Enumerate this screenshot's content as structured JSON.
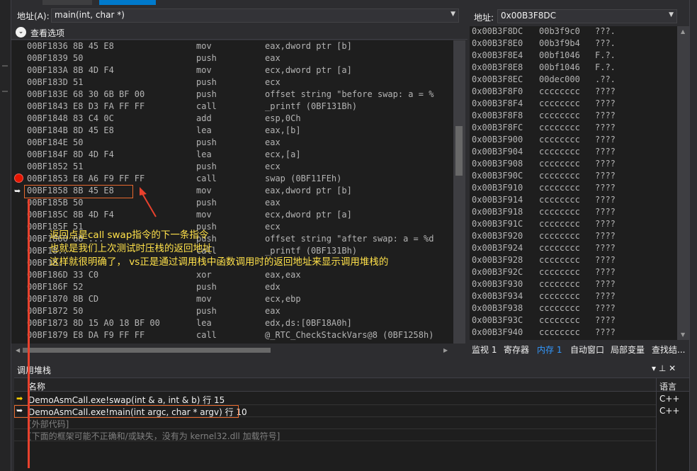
{
  "disasm": {
    "address_label": "地址(A):",
    "address_value": "main(int, char *)",
    "view_options_label": "查看选项",
    "rows": [
      {
        "addr": "00BF1836 8B 45 E8",
        "op": "mov",
        "arg": "eax,dword ptr [b]"
      },
      {
        "addr": "00BF1839 50",
        "op": "push",
        "arg": "eax"
      },
      {
        "addr": "00BF183A 8B 4D F4",
        "op": "mov",
        "arg": "ecx,dword ptr [a]"
      },
      {
        "addr": "00BF183D 51",
        "op": "push",
        "arg": "ecx"
      },
      {
        "addr": "00BF183E 68 30 6B BF 00",
        "op": "push",
        "arg": "offset string \"before swap: a = %"
      },
      {
        "addr": "00BF1843 E8 D3 FA FF FF",
        "op": "call",
        "arg": "_printf (0BF131Bh)"
      },
      {
        "addr": "00BF1848 83 C4 0C",
        "op": "add",
        "arg": "esp,0Ch"
      },
      {
        "addr": "00BF184B 8D 45 E8",
        "op": "lea",
        "arg": "eax,[b]"
      },
      {
        "addr": "00BF184E 50",
        "op": "push",
        "arg": "eax"
      },
      {
        "addr": "00BF184F 8D 4D F4",
        "op": "lea",
        "arg": "ecx,[a]"
      },
      {
        "addr": "00BF1852 51",
        "op": "push",
        "arg": "ecx"
      },
      {
        "addr": "00BF1853 E8 A6 F9 FF FF",
        "op": "call",
        "arg": "swap (0BF11FEh)"
      },
      {
        "addr": "00BF1858 8B 45 E8",
        "op": "mov",
        "arg": "eax,dword ptr [b]"
      },
      {
        "addr": "00BF185B 50",
        "op": "push",
        "arg": "eax"
      },
      {
        "addr": "00BF185C 8B 4D F4",
        "op": "mov",
        "arg": "ecx,dword ptr [a]"
      },
      {
        "addr": "00BF185F 51",
        "op": "push",
        "arg": "ecx"
      },
      {
        "addr": "00BF1860 68 ...",
        "op": "push",
        "arg": "offset string \"after swap: a = %d"
      },
      {
        "addr": "00BF18..",
        "op": "call",
        "arg": "_printf (0BF131Bh)"
      },
      {
        "addr": "00BF18..",
        "op": "",
        "arg": ""
      },
      {
        "addr": "00BF186D 33 C0",
        "op": "xor",
        "arg": "eax,eax"
      },
      {
        "addr": "00BF186F 52",
        "op": "push",
        "arg": "edx"
      },
      {
        "addr": "00BF1870 8B CD",
        "op": "mov",
        "arg": "ecx,ebp"
      },
      {
        "addr": "00BF1872 50",
        "op": "push",
        "arg": "eax"
      },
      {
        "addr": "00BF1873 8D 15 A0 18 BF 00",
        "op": "lea",
        "arg": "edx,ds:[0BF18A0h]"
      },
      {
        "addr": "00BF1879 E8 DA F9 FF FF",
        "op": "call",
        "arg": "@_RTC_CheckStackVars@8 (0BF1258h)"
      }
    ]
  },
  "memory": {
    "address_label": "地址:",
    "address_value": "0x00B3F8DC",
    "rows": [
      {
        "a": "0x00B3F8DC",
        "v": "00b3f9c0",
        "c": "???."
      },
      {
        "a": "0x00B3F8E0",
        "v": "00b3f9b4",
        "c": "???."
      },
      {
        "a": "0x00B3F8E4",
        "v": "00bf1046",
        "c": "F.?."
      },
      {
        "a": "0x00B3F8E8",
        "v": "00bf1046",
        "c": "F.?."
      },
      {
        "a": "0x00B3F8EC",
        "v": "00dec000",
        "c": ".??."
      },
      {
        "a": "0x00B3F8F0",
        "v": "cccccccc",
        "c": "????"
      },
      {
        "a": "0x00B3F8F4",
        "v": "cccccccc",
        "c": "????"
      },
      {
        "a": "0x00B3F8F8",
        "v": "cccccccc",
        "c": "????"
      },
      {
        "a": "0x00B3F8FC",
        "v": "cccccccc",
        "c": "????"
      },
      {
        "a": "0x00B3F900",
        "v": "cccccccc",
        "c": "????"
      },
      {
        "a": "0x00B3F904",
        "v": "cccccccc",
        "c": "????"
      },
      {
        "a": "0x00B3F908",
        "v": "cccccccc",
        "c": "????"
      },
      {
        "a": "0x00B3F90C",
        "v": "cccccccc",
        "c": "????"
      },
      {
        "a": "0x00B3F910",
        "v": "cccccccc",
        "c": "????"
      },
      {
        "a": "0x00B3F914",
        "v": "cccccccc",
        "c": "????"
      },
      {
        "a": "0x00B3F918",
        "v": "cccccccc",
        "c": "????"
      },
      {
        "a": "0x00B3F91C",
        "v": "cccccccc",
        "c": "????"
      },
      {
        "a": "0x00B3F920",
        "v": "cccccccc",
        "c": "????"
      },
      {
        "a": "0x00B3F924",
        "v": "cccccccc",
        "c": "????"
      },
      {
        "a": "0x00B3F928",
        "v": "cccccccc",
        "c": "????"
      },
      {
        "a": "0x00B3F92C",
        "v": "cccccccc",
        "c": "????"
      },
      {
        "a": "0x00B3F930",
        "v": "cccccccc",
        "c": "????"
      },
      {
        "a": "0x00B3F934",
        "v": "cccccccc",
        "c": "????"
      },
      {
        "a": "0x00B3F938",
        "v": "cccccccc",
        "c": "????"
      },
      {
        "a": "0x00B3F93C",
        "v": "cccccccc",
        "c": "????"
      },
      {
        "a": "0x00B3F940",
        "v": "cccccccc",
        "c": "????"
      }
    ],
    "bottom_tabs": [
      "监视 1",
      "寄存器",
      "内存 1",
      "自动窗口",
      "局部变量",
      "查找结..."
    ]
  },
  "callstack": {
    "title": "调用堆栈",
    "col_name": "名称",
    "col_lang": "语言",
    "rows": [
      {
        "name": "DemoAsmCall.exe!swap(int & a, int & b) 行 15",
        "lang": "C++"
      },
      {
        "name": "DemoAsmCall.exe!main(int argc, char * argv) 行 10",
        "lang": "C++"
      },
      {
        "name": "[外部代码]",
        "lang": ""
      },
      {
        "name": "[下面的框架可能不正确和/或缺失，没有为 kernel32.dll 加载符号]",
        "lang": ""
      }
    ]
  },
  "annotation": {
    "lines": [
      "返回点是call swap指令的下一条指令",
      "也就是我们上次测试时压栈的返回地址",
      "这样就很明确了，  vs正是通过调用栈中函数调用时的返回地址来显示调用堆栈的"
    ]
  },
  "colors": {
    "accent": "#007acc",
    "annotation_text": "#ffe14a",
    "annotation_box": "#e8692d",
    "breakpoint": "#e51400"
  }
}
